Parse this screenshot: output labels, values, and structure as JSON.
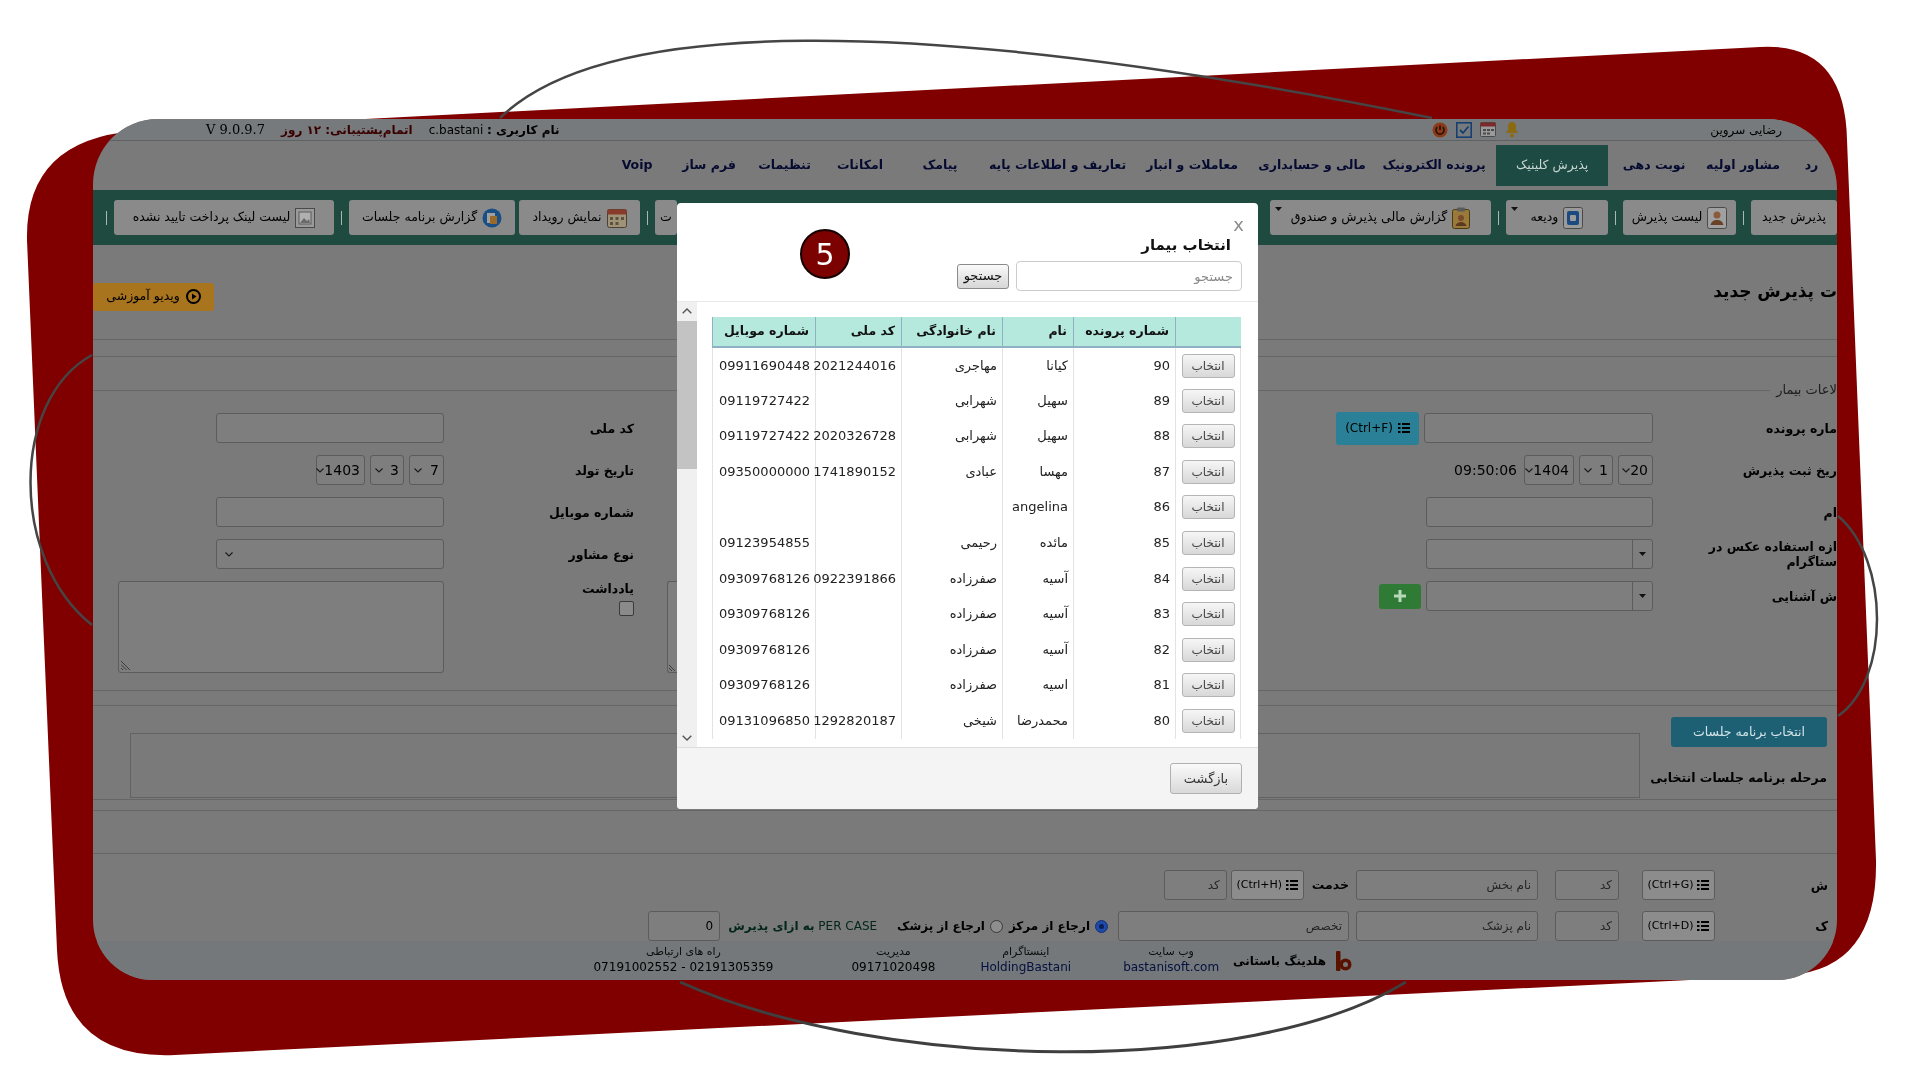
{
  "header": {
    "user_display": "رضایی سروین",
    "user": "**نام کاربری :** c.bastani",
    "support": "اتمام‌پشتیبانی: ۱۲ روز",
    "version": "V 9.0.9.7"
  },
  "nav": [
    {
      "label": "رد",
      "selected": false
    },
    {
      "label": "مشاور اولیه",
      "selected": false
    },
    {
      "label": "نوبت دهی",
      "selected": false
    },
    {
      "label": "پذیرش کلینیک",
      "selected": true
    },
    {
      "label": "پرونده الکترونیک",
      "selected": false
    },
    {
      "label": "مالی و حسابداری",
      "selected": false
    },
    {
      "label": "معاملات و انبار",
      "selected": false
    },
    {
      "label": "تعاریف و اطلاعات پایه",
      "selected": false
    },
    {
      "label": "پیامک",
      "selected": false
    },
    {
      "label": "امکانات",
      "selected": false
    },
    {
      "label": "تنظیمات",
      "selected": false
    },
    {
      "label": "فرم ساز",
      "selected": false
    },
    {
      "label": "Voip",
      "selected": false
    }
  ],
  "toolbar": [
    {
      "items": [
        {
          "label": "پذیرش جدید",
          "caret": false,
          "divider": true
        },
        {
          "label": "لیست پذیرش",
          "caret": false,
          "divider": true
        },
        {
          "label": "ودیعه",
          "caret": true,
          "divider": true
        },
        {
          "label": "گزارش مالی پذیرش و صندوق",
          "caret": true,
          "divider": false
        }
      ]
    },
    {
      "items": [
        {
          "label": "ت",
          "caret": false,
          "divider": true
        },
        {
          "label": "نمایش رویداد",
          "caret": false,
          "divider": false
        },
        {
          "label": "گزارش برنامه جلسات",
          "caret": false,
          "divider": true
        },
        {
          "label": "لیست لینک پرداخت تایید نشده",
          "caret": false,
          "divider": true
        }
      ]
    }
  ],
  "page": {
    "title": "ت پذیرش جدید",
    "video_button": "ویدیو آموزشی",
    "section_title": "لاعات بیمار"
  },
  "form_right": [
    {
      "kind": "lookup",
      "label": "ماره پرونده",
      "button": "(Ctrl+F)"
    },
    {
      "kind": "date",
      "label": "ریخ ثبت پذیرش",
      "parts": [
        "20",
        "1",
        "1404"
      ],
      "time": "09:50:06"
    },
    {
      "kind": "input",
      "label": "ام"
    },
    {
      "kind": "combo",
      "label": "ازه استفاده عکس در ستاگرام"
    },
    {
      "kind": "combo_add",
      "label": "ش آشنایی"
    }
  ],
  "form_left": [
    {
      "kind": "input",
      "label": "کد ملی"
    },
    {
      "kind": "date",
      "label": "تاریخ تولد",
      "parts": [
        "7",
        "3",
        "1403"
      ]
    },
    {
      "kind": "input",
      "label": "شماره موبایل"
    },
    {
      "kind": "select",
      "label": "نوع مشاور"
    },
    {
      "kind": "note",
      "label": "یادداشت",
      "checked": false
    }
  ],
  "sessions": {
    "button": "انتخاب برنامه جلسات",
    "label": "مرحله برنامه جلسات انتخابی"
  },
  "department_row": {
    "label": "ش",
    "button": "(Ctrl+G)",
    "code_placeholder": "کد",
    "name_placeholder": "نام بخش",
    "service_label": "خدمت",
    "service_button": "(Ctrl+H)",
    "service_code_placeholder": "کد"
  },
  "doctor_row": {
    "label": "ک",
    "button": "(Ctrl+D)",
    "code_placeholder": "کد",
    "name_placeholder": "نام پزشک",
    "specialty_placeholder": "تخصص",
    "referral": [
      {
        "label": "ارجاع از مرکز",
        "selected": true
      },
      {
        "label": "ارجاع از پزشک",
        "selected": false
      }
    ],
    "per_case": "PER CASE **به ازای پذیرش**",
    "per_case_value": "0"
  },
  "footer": {
    "company": "هلدینگ باستانی",
    "contacts": [
      {
        "kind": "link",
        "label": "وب سایت",
        "value": "bastanisoft.com"
      },
      {
        "kind": "link",
        "label": "اینستاگرام",
        "value": "HoldingBastani"
      },
      {
        "kind": "text",
        "label": "مدیریت",
        "value": "09171020498"
      },
      {
        "kind": "text",
        "label": "راه های ارتباطی",
        "value": "07191002552 - 02191305359"
      }
    ]
  },
  "dialog": {
    "close": "x",
    "title": "انتخاب بیمار",
    "search_placeholder": "جستجو",
    "search_button": "جستجو",
    "badge": "5",
    "columns": [
      "شماره پرونده",
      "نام",
      "نام خانوادگی",
      "کد ملی",
      "شماره موبایل"
    ],
    "rows": [
      {
        "button": "انتخاب",
        "file_no": "90",
        "first_name": "کیانا",
        "last_name": "مهاجری",
        "national_code": "2021244016",
        "mobile": "09911690448"
      },
      {
        "button": "انتخاب",
        "file_no": "89",
        "first_name": "سهیل",
        "last_name": "شهرابی",
        "mobile": "09119727422"
      },
      {
        "button": "انتخاب",
        "file_no": "88",
        "first_name": "سهیل",
        "last_name": "شهرابی",
        "national_code": "2020326728",
        "mobile": "09119727422"
      },
      {
        "button": "انتخاب",
        "file_no": "87",
        "first_name": "مهسا",
        "last_name": "عبادی",
        "national_code": "1741890152",
        "mobile": "09350000000"
      },
      {
        "button": "انتخاب",
        "file_no": "86",
        "first_name": "angelina"
      },
      {
        "button": "انتخاب",
        "file_no": "85",
        "first_name": "مائده",
        "last_name": "رحیمی",
        "mobile": "09123954855"
      },
      {
        "button": "انتخاب",
        "file_no": "84",
        "first_name": "آسیه",
        "last_name": "صفرزاده",
        "national_code": "0922391866",
        "mobile": "09309768126"
      },
      {
        "button": "انتخاب",
        "file_no": "83",
        "first_name": "آسیه",
        "last_name": "صفرزاده",
        "mobile": "09309768126"
      },
      {
        "button": "انتخاب",
        "file_no": "82",
        "first_name": "آسیه",
        "last_name": "صفرزاده",
        "mobile": "09309768126"
      },
      {
        "button": "انتخاب",
        "file_no": "81",
        "first_name": "اسیه",
        "last_name": "صفرزاده",
        "mobile": "09309768126"
      },
      {
        "button": "انتخاب",
        "file_no": "80",
        "first_name": "محمدرضا",
        "last_name": "شیخی",
        "national_code": "1292820187",
        "mobile": "09131096850"
      }
    ],
    "back_button": "بازگشت"
  }
}
